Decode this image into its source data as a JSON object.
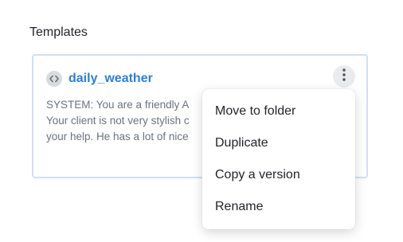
{
  "section": {
    "title": "Templates"
  },
  "card": {
    "icon": "code-icon",
    "title": "daily_weather",
    "more_icon": "more-vertical-icon",
    "preview_lines": [
      "SYSTEM: You are a friendly A",
      "Your client is not very stylish c",
      "your help. He has a lot of nice"
    ]
  },
  "menu": {
    "items": [
      {
        "label": "Move to folder"
      },
      {
        "label": "Duplicate"
      },
      {
        "label": "Copy a version"
      },
      {
        "label": "Rename"
      }
    ]
  },
  "colors": {
    "accent": "#2b7fd6",
    "card_border": "#cfe0f5",
    "muted_text": "#6b7280"
  }
}
